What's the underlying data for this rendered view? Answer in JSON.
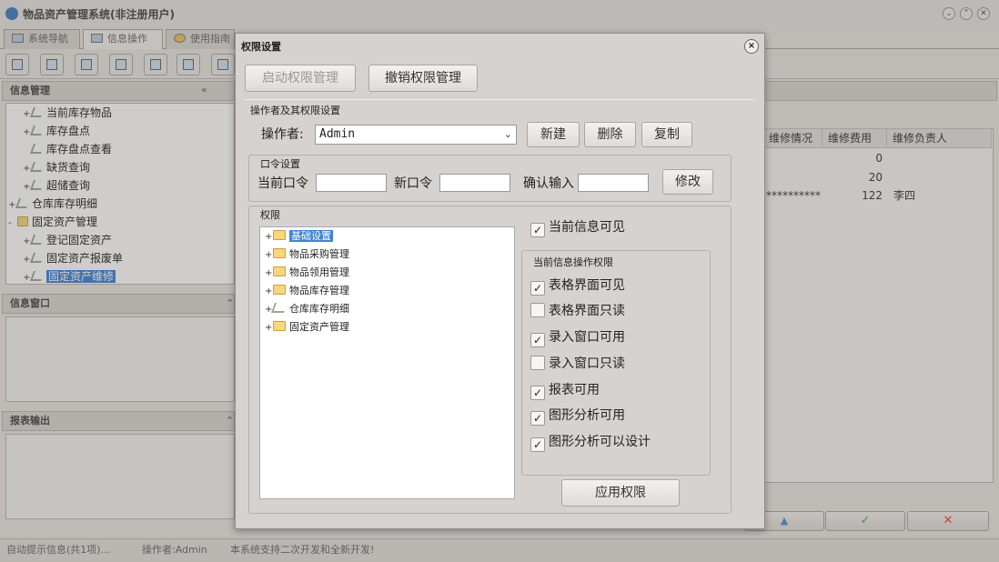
{
  "app": {
    "title": "物品资产管理系统(非注册用户)",
    "tabs": [
      "系统导航",
      "信息操作",
      "使用指南"
    ]
  },
  "left": {
    "info_mgmt_title": "信息管理",
    "info_window_title": "信息窗口",
    "report_output_title": "报表输出",
    "tree": [
      {
        "label": "当前库存物品",
        "level": 2,
        "icon": "tool-icon"
      },
      {
        "label": "库存盘点",
        "level": 2,
        "icon": "tool-icon"
      },
      {
        "label": "库存盘点查看",
        "level": 2,
        "icon": "tool-icon"
      },
      {
        "label": "缺货查询",
        "level": 2,
        "icon": "tool-icon"
      },
      {
        "label": "超储查询",
        "level": 2,
        "icon": "tool-icon"
      },
      {
        "label": "仓库库存明细",
        "level": 1,
        "icon": "tool-icon"
      },
      {
        "label": "固定资产管理",
        "level": 1,
        "icon": "folder-icon"
      },
      {
        "label": "登记固定资产",
        "level": 2,
        "icon": "tool-icon"
      },
      {
        "label": "固定资产报废单",
        "level": 2,
        "icon": "tool-icon"
      },
      {
        "label": "固定资产维修",
        "level": 2,
        "icon": "tool-icon",
        "selected": true
      }
    ]
  },
  "grid": {
    "headers": [
      "维修情况",
      "维修费用",
      "维修负责人"
    ],
    "rows": [
      {
        "status": "",
        "cost": "0",
        "person": ""
      },
      {
        "status": "",
        "cost": "20",
        "person": ""
      },
      {
        "status": "**********",
        "cost": "122",
        "person": "李四"
      }
    ]
  },
  "status_bar": {
    "hint": "自动提示信息(共1项)...",
    "operator": "操作者:Admin",
    "notice": "本系统支持二次开发和全新开发!"
  },
  "dialog": {
    "title": "权限设置",
    "close_symbol": "×",
    "enable_btn": "启动权限管理",
    "revoke_btn": "撤销权限管理",
    "operator_section": "操作者及其权限设置",
    "operator_label": "操作者:",
    "operator_value": "Admin",
    "new_btn": "新建",
    "delete_btn": "删除",
    "copy_btn": "复制",
    "password_group": "口令设置",
    "current_pw_label": "当前口令",
    "new_pw_label": "新口令",
    "confirm_pw_label": "确认输入",
    "modify_btn": "修改",
    "perm_group": "权限",
    "perm_tree": [
      {
        "label": "基础设置",
        "icon": "folder-icon",
        "selected": true
      },
      {
        "label": "物品采购管理",
        "icon": "folder-icon"
      },
      {
        "label": "物品领用管理",
        "icon": "folder-icon"
      },
      {
        "label": "物品库存管理",
        "icon": "folder-icon"
      },
      {
        "label": "仓库库存明细",
        "icon": "tool-icon"
      },
      {
        "label": "固定资产管理",
        "icon": "folder-icon"
      }
    ],
    "visible_check": {
      "label": "当前信息可见",
      "checked": true
    },
    "ops_group": "当前信息操作权限",
    "ops": [
      {
        "label": "表格界面可见",
        "checked": true
      },
      {
        "label": "表格界面只读",
        "checked": false
      },
      {
        "label": "录入窗口可用",
        "checked": true
      },
      {
        "label": "录入窗口只读",
        "checked": false
      },
      {
        "label": "报表可用",
        "checked": true
      },
      {
        "label": "图形分析可用",
        "checked": true
      },
      {
        "label": "图形分析可以设计",
        "checked": true
      }
    ],
    "apply_btn": "应用权限"
  }
}
